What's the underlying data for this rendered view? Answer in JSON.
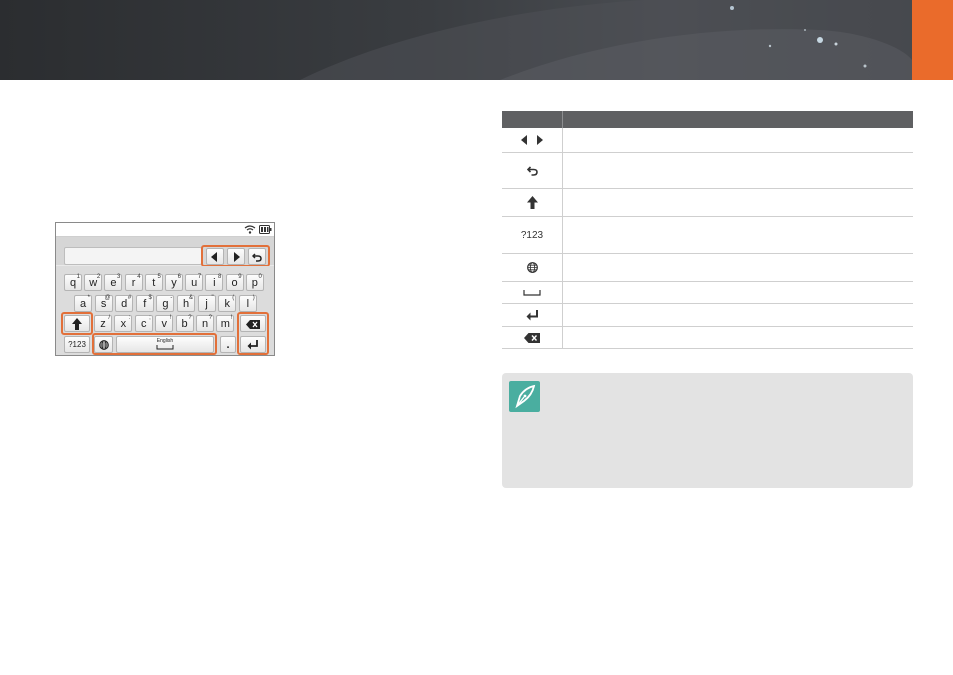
{
  "colors": {
    "accent": "#ea6b2b",
    "highlight": "#e2703a",
    "table_header": "#5f6062",
    "note_badge": "#4aaea0"
  },
  "keyboard": {
    "rows": [
      {
        "keys": [
          {
            "label": "q",
            "sup": "1"
          },
          {
            "label": "w",
            "sup": "2"
          },
          {
            "label": "e",
            "sup": "3"
          },
          {
            "label": "r",
            "sup": "4"
          },
          {
            "label": "t",
            "sup": "5"
          },
          {
            "label": "y",
            "sup": "6"
          },
          {
            "label": "u",
            "sup": "7"
          },
          {
            "label": "i",
            "sup": "8"
          },
          {
            "label": "o",
            "sup": "9"
          },
          {
            "label": "p",
            "sup": "0"
          }
        ]
      },
      {
        "keys": [
          {
            "label": "a",
            "sup": "*"
          },
          {
            "label": "s",
            "sup": "@"
          },
          {
            "label": "d",
            "sup": "#"
          },
          {
            "label": "f",
            "sup": "$"
          },
          {
            "label": "g",
            "sup": "-"
          },
          {
            "label": "h",
            "sup": "&"
          },
          {
            "label": "j",
            "sup": "\""
          },
          {
            "label": "k",
            "sup": "("
          },
          {
            "label": "l",
            "sup": ")"
          }
        ]
      },
      {
        "keys": [
          {
            "label": "z",
            "sup": "/"
          },
          {
            "label": "x",
            "sup": ":"
          },
          {
            "label": "c",
            "sup": ";"
          },
          {
            "label": "v",
            "sup": "!"
          },
          {
            "label": "b",
            "sup": "?"
          },
          {
            "label": "n",
            "sup": "?"
          },
          {
            "label": "m",
            "sup": "!"
          }
        ]
      }
    ],
    "num_key": "?123",
    "space_label": "English",
    "period": "."
  },
  "table": {
    "rows": [
      {
        "icon": "left-right-arrows-icon"
      },
      {
        "icon": "undo-icon"
      },
      {
        "icon": "shift-arrow-icon"
      },
      {
        "icon_text": "?123"
      },
      {
        "icon": "globe-icon"
      },
      {
        "icon": "space-icon"
      },
      {
        "icon": "enter-icon"
      },
      {
        "icon": "backspace-icon"
      }
    ]
  },
  "note": {
    "icon": "pen-nib-icon"
  }
}
